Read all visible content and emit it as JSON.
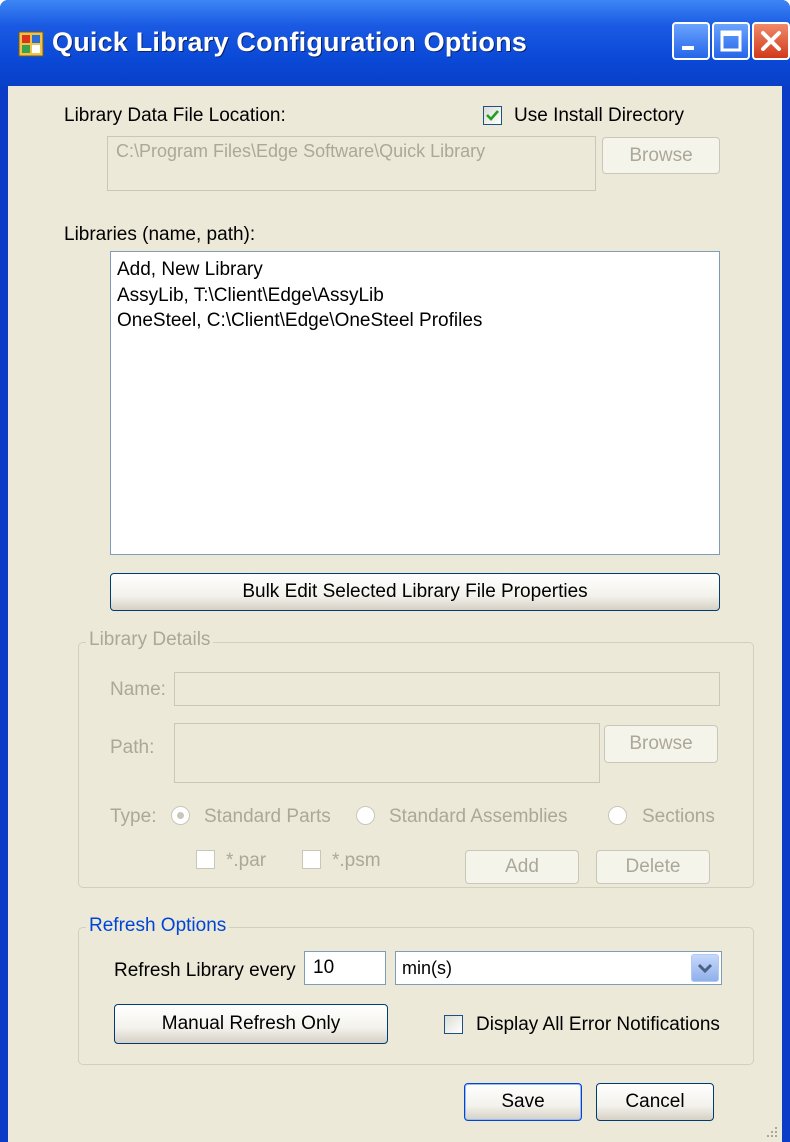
{
  "window": {
    "title": "Quick Library Configuration Options"
  },
  "data_file": {
    "label": "Library Data File Location:",
    "use_install_label": "Use Install Directory",
    "use_install_checked": true,
    "path_value": "C:\\Program Files\\Edge Software\\Quick Library",
    "browse_label": "Browse"
  },
  "libraries": {
    "label": "Libraries (name, path):",
    "items": [
      " Add, New Library",
      "AssyLib, T:\\Client\\Edge\\AssyLib",
      "OneSteel, C:\\Client\\Edge\\OneSteel Profiles"
    ],
    "bulk_edit_label": "Bulk Edit Selected Library File Properties"
  },
  "details": {
    "legend": "Library Details",
    "name_label": "Name:",
    "path_label": "Path:",
    "browse_label": "Browse",
    "type_label": "Type:",
    "types": [
      "Standard Parts",
      "Standard Assemblies",
      "Sections"
    ],
    "selected_type": "Standard Parts",
    "ext_par": "*.par",
    "ext_psm": "*.psm",
    "add_label": "Add",
    "delete_label": "Delete"
  },
  "refresh": {
    "legend": "Refresh Options",
    "every_label": "Refresh Library every",
    "interval_value": "10",
    "unit_value": "min(s)",
    "manual_label": "Manual Refresh Only",
    "display_errors_label": "Display All Error Notifications",
    "display_errors_checked": false
  },
  "footer": {
    "save_label": "Save",
    "cancel_label": "Cancel"
  },
  "colors": {
    "title_bar": "#0a48d6",
    "dialog_bg": "#ece9d8",
    "group_legend_blue": "#0046d5",
    "disabled_text": "#aca899"
  },
  "icons": [
    "app-icon",
    "minimize-icon",
    "maximize-icon",
    "close-icon",
    "checkmark-icon",
    "dropdown-arrow-icon",
    "resize-grip-icon"
  ]
}
